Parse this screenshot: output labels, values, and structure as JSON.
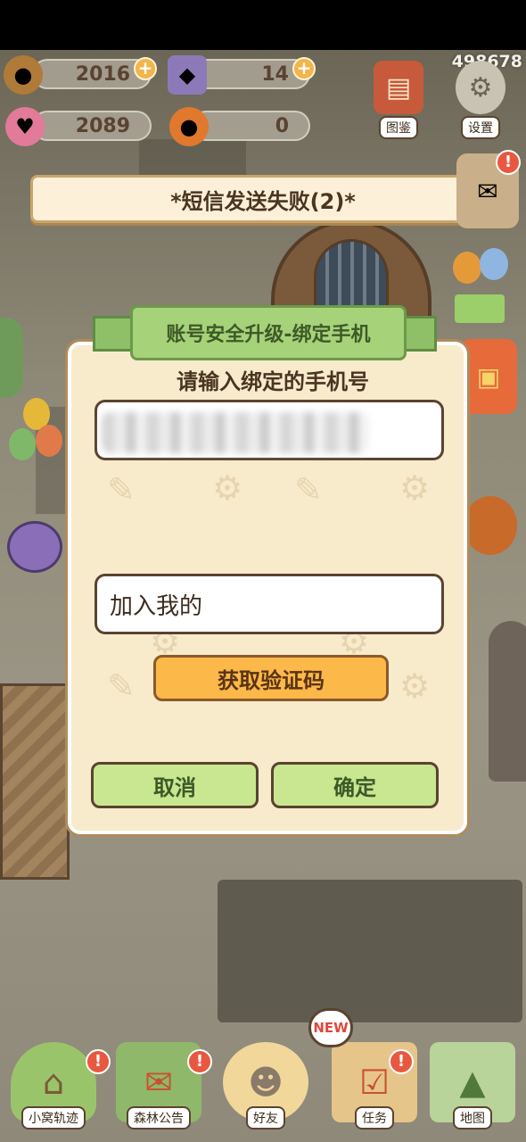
{
  "hud": {
    "acorns": "2016",
    "gems": "14",
    "hearts": "2089",
    "pumpkins": "0",
    "user_id": "498678",
    "plus_symbol": "+",
    "buttons": [
      {
        "label": "图鉴",
        "icon": "book-icon"
      },
      {
        "label": "设置",
        "icon": "gear-icon"
      }
    ]
  },
  "toast": {
    "message": "*短信发送失败(2)*",
    "icon": "paw-icon"
  },
  "side": {
    "alert_symbol": "!"
  },
  "dialog": {
    "ribbon_title": "账号安全升级-绑定手机",
    "prompt": "请输入绑定的手机号",
    "phone_value": "",
    "code_value": "加入我的",
    "get_code_button": "获取验证码",
    "cancel_button": "取消",
    "confirm_button": "确定"
  },
  "nav": {
    "new_badge": "NEW",
    "items": [
      {
        "label": "小窝轨迹",
        "icon": "house-icon",
        "alert": true
      },
      {
        "label": "森林公告",
        "icon": "envelope-icon",
        "alert": true
      },
      {
        "label": "好友",
        "icon": "friends-icon",
        "alert": false
      },
      {
        "label": "任务",
        "icon": "clipboard-icon",
        "alert": true
      },
      {
        "label": "地图",
        "icon": "map-icon",
        "alert": false
      }
    ]
  },
  "colors": {
    "dialog_bg": "#f7ebcb",
    "ribbon_green": "#a6d27a",
    "button_orange": "#fcb849",
    "button_green": "#c9e690",
    "alert_red": "#e85840"
  }
}
